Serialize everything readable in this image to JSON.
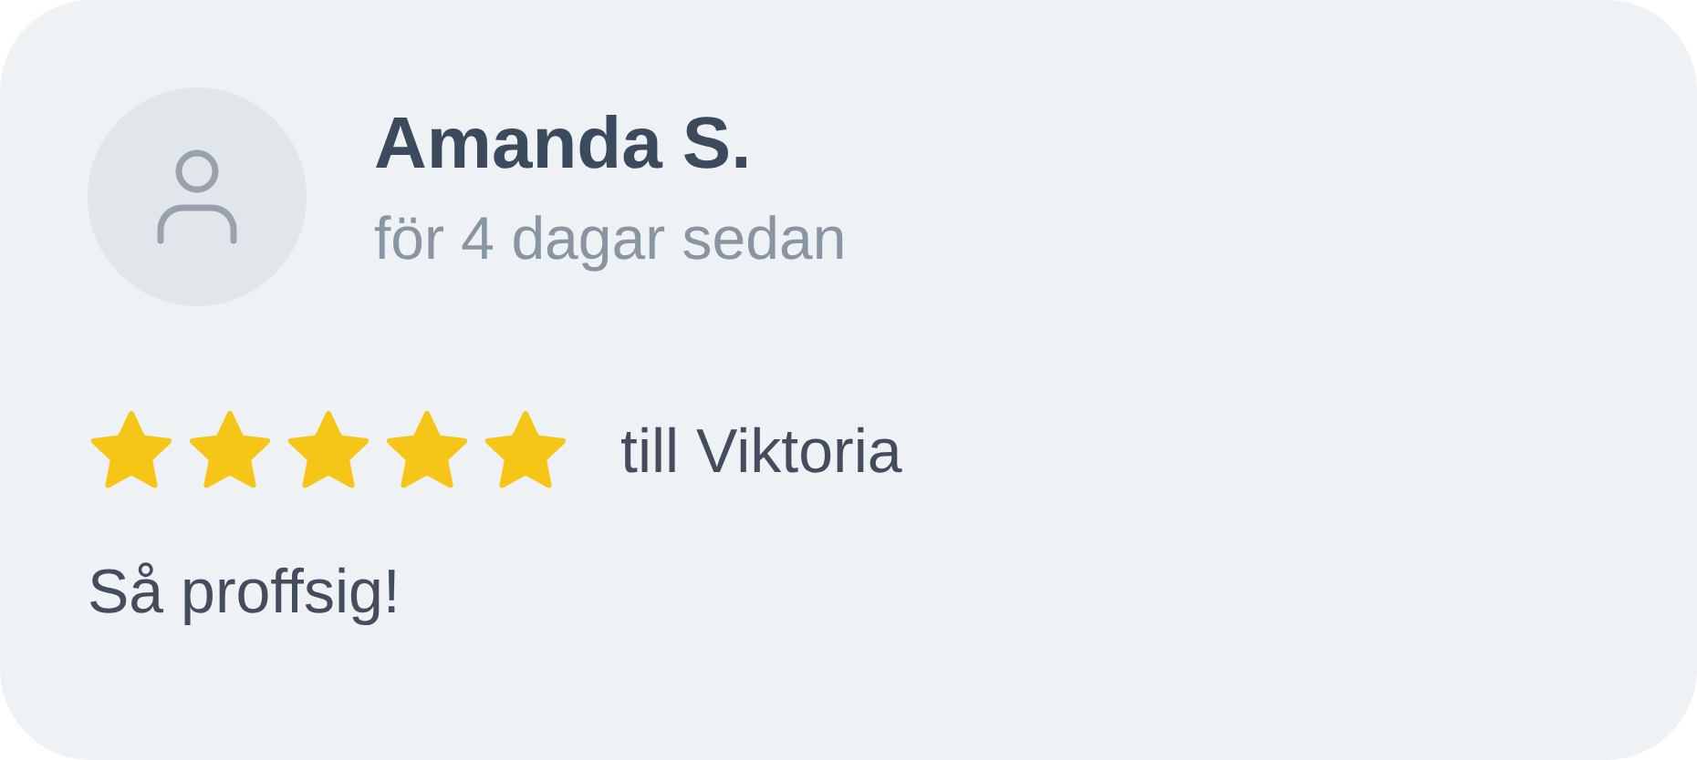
{
  "review": {
    "author": "Amanda S.",
    "time": "för 4 dagar sedan",
    "stars": 5,
    "recipient": "till Viktoria",
    "text": "Så proffsig!"
  }
}
